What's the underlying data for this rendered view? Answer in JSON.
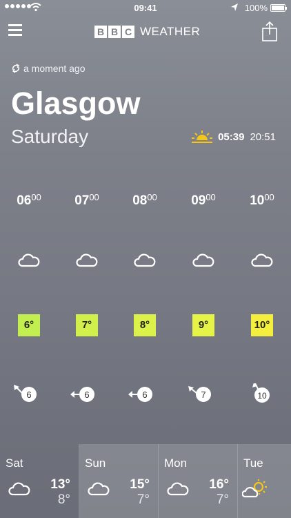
{
  "status_bar": {
    "time": "09:41",
    "battery": "100%"
  },
  "header": {
    "logo_letters": [
      "B",
      "B",
      "C"
    ],
    "logo_word": "WEATHER"
  },
  "location": {
    "updated": "a moment ago",
    "city": "Glasgow",
    "day": "Saturday",
    "sunrise": "05:39",
    "sunset": "20:51"
  },
  "hourly": [
    {
      "hour": "06",
      "minutes": "00",
      "icon": "cloud-icon",
      "temp": "6°",
      "temp_color": "#c3ee4f",
      "wind_speed": "6"
    },
    {
      "hour": "07",
      "minutes": "00",
      "icon": "cloud-icon",
      "temp": "7°",
      "temp_color": "#d2f04b",
      "wind_speed": "6"
    },
    {
      "hour": "08",
      "minutes": "00",
      "icon": "cloud-icon",
      "temp": "8°",
      "temp_color": "#dcf24a",
      "wind_speed": "6"
    },
    {
      "hour": "09",
      "minutes": "00",
      "icon": "cloud-icon",
      "temp": "9°",
      "temp_color": "#e6f447",
      "wind_speed": "7"
    },
    {
      "hour": "10",
      "minutes": "00",
      "icon": "cloud-icon",
      "temp": "10°",
      "temp_color": "#f4ef3c",
      "wind_speed": "10"
    }
  ],
  "daily": [
    {
      "day": "Sat",
      "icon": "cloud-icon",
      "high": "13°",
      "low": "8°"
    },
    {
      "day": "Sun",
      "icon": "cloud-icon",
      "high": "15°",
      "low": "7°"
    },
    {
      "day": "Mon",
      "icon": "cloud-icon",
      "high": "16°",
      "low": "7°"
    },
    {
      "day": "Tue",
      "icon": "sun-cloud-icon",
      "high": "",
      "low": ""
    }
  ],
  "colors": {
    "sun_accent": "#f5c518"
  }
}
